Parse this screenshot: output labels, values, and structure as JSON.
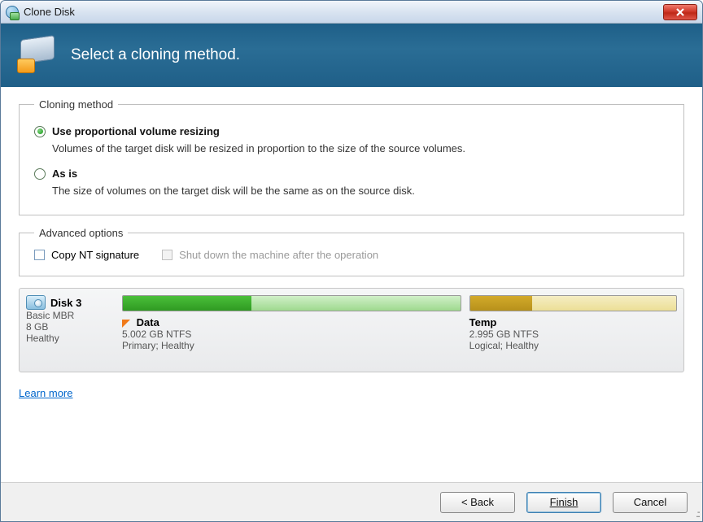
{
  "window": {
    "title": "Clone Disk",
    "header": "Select a cloning method."
  },
  "section_cloning": {
    "legend": "Cloning method",
    "opt1_title": "Use proportional volume resizing",
    "opt1_desc": "Volumes of the target disk will be resized in proportion to the size of the source volumes.",
    "opt1_selected": true,
    "opt2_title": "As is",
    "opt2_desc": "The size of volumes on the target disk will be the same as on the source disk.",
    "opt2_selected": false
  },
  "section_advanced": {
    "legend": "Advanced options",
    "cb1_label": "Copy NT signature",
    "cb2_label": "Shut down the machine after the operation"
  },
  "disk": {
    "name": "Disk 3",
    "type": "Basic MBR",
    "size": "8 GB",
    "status": "Healthy",
    "partitions": [
      {
        "name": "Data",
        "size": "5.002 GB NTFS",
        "detail": "Primary; Healthy",
        "fill_pct": 38,
        "width_pct": 62,
        "color": "green",
        "flagged": true
      },
      {
        "name": "Temp",
        "size": "2.995 GB NTFS",
        "detail": "Logical; Healthy",
        "fill_pct": 30,
        "width_pct": 38,
        "color": "yellow",
        "flagged": false
      }
    ]
  },
  "learn_more": "Learn more",
  "buttons": {
    "back": "< Back",
    "finish": "Finish",
    "cancel": "Cancel"
  }
}
